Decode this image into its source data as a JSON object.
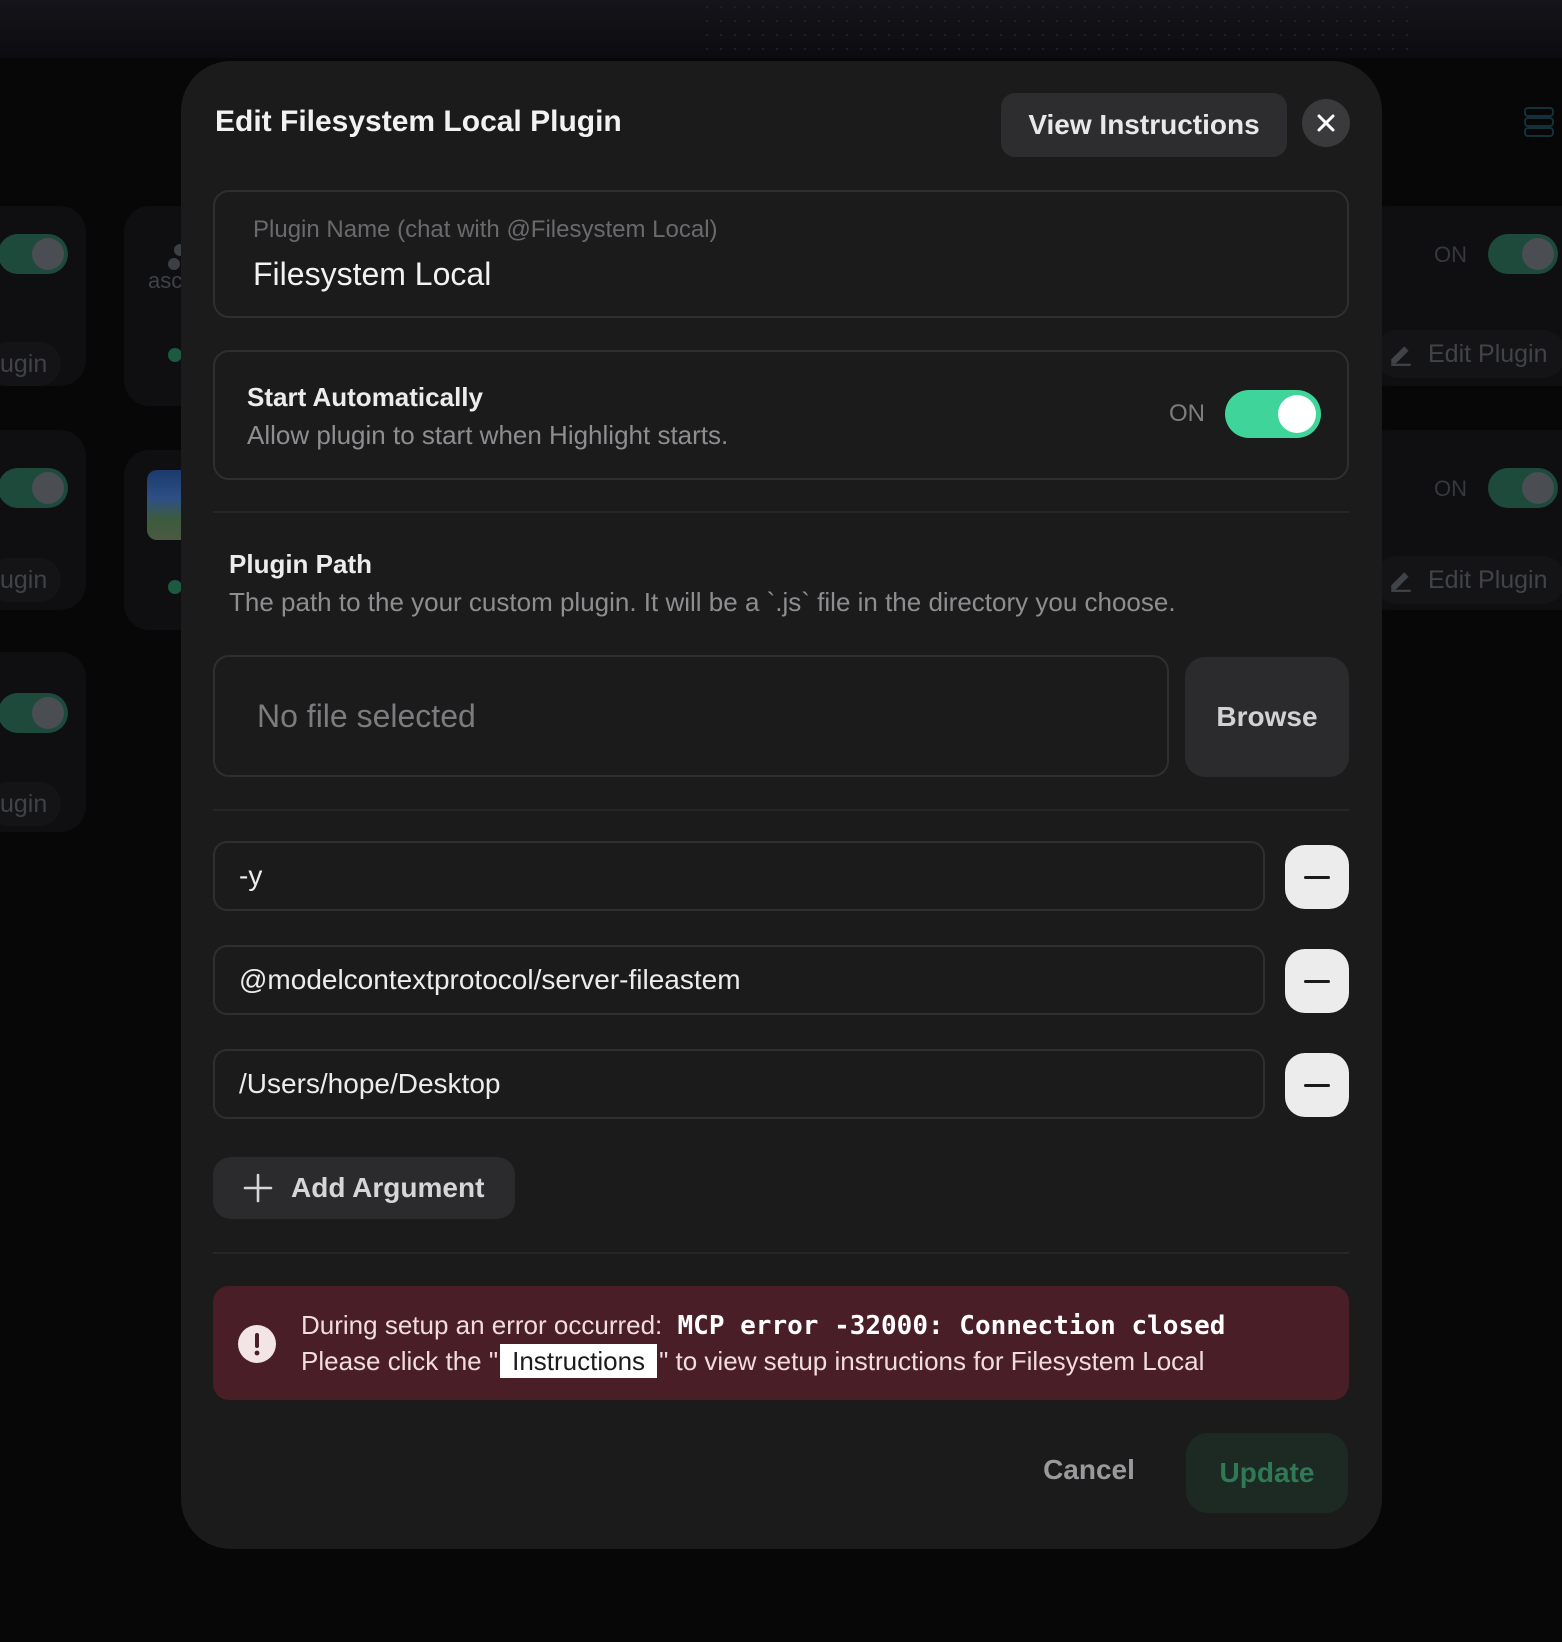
{
  "modal": {
    "title": "Edit Filesystem Local Plugin",
    "view_instructions_label": "View Instructions",
    "plugin_name": {
      "label": "Plugin Name (chat with @Filesystem Local)",
      "value": "Filesystem Local"
    },
    "start_automatically": {
      "title": "Start Automatically",
      "description": "Allow plugin to start when Highlight starts.",
      "status": "ON",
      "enabled": true
    },
    "plugin_path": {
      "title": "Plugin Path",
      "description": "The path to the your custom plugin. It will be a `.js` file in the directory you choose.",
      "file_text": "No file selected",
      "browse_label": "Browse"
    },
    "arguments": [
      "-y",
      "@modelcontextprotocol/server-fileastem",
      "/Users/hope/Desktop"
    ],
    "add_argument_label": "Add Argument",
    "error": {
      "prefix": "During setup an error occurred:",
      "code": "MCP error -32000: Connection closed",
      "line2_before": "Please click the \"",
      "instructions_chip": "Instructions",
      "line2_after": "\" to view setup instructions for Filesystem Local"
    },
    "cancel_label": "Cancel",
    "update_label": "Update"
  },
  "background": {
    "pill_label": "ugin",
    "status_on": "ON",
    "edit_plugin_label": "Edit Plugin",
    "card_logo_text": "asc"
  },
  "colors": {
    "modal_bg": "#1b1b1c",
    "toggle_on": "#3fd59a",
    "error_bg": "#4a1e27",
    "update_text": "#2f7a55"
  }
}
